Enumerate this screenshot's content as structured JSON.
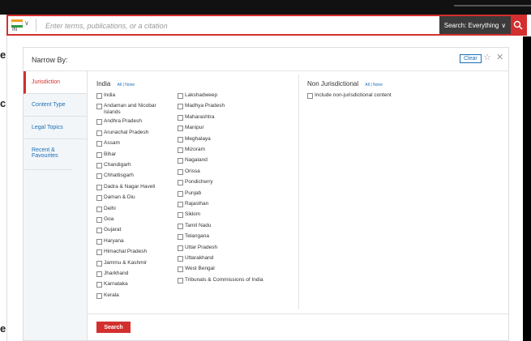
{
  "search": {
    "country_code": "IN",
    "placeholder": "Enter terms, publications, or a citation",
    "scope_label": "Search: Everything",
    "accent_color": "#d32f2f"
  },
  "panel": {
    "title": "Narrow By:",
    "clear_label": "Clear",
    "sidebar": [
      {
        "label": "Jurisdiction",
        "active": true
      },
      {
        "label": "Content Type",
        "active": false
      },
      {
        "label": "Legal Topics",
        "active": false
      },
      {
        "label": "Recent & Favourites",
        "active": false
      }
    ],
    "india": {
      "heading": "India",
      "all_label": "All",
      "none_label": "None",
      "col1": [
        "India",
        "Andaman and Nicobar Islands",
        "Andhra Pradesh",
        "Arunachal Pradesh",
        "Assam",
        "Bihar",
        "Chandigarh",
        "Chhattisgarh",
        "Dadra & Nagar Haveli",
        "Daman & Diu",
        "Delhi",
        "Goa",
        "Gujarat",
        "Haryana",
        "Himachal Pradesh",
        "Jammu & Kashmir",
        "Jharkhand",
        "Karnataka",
        "Kerala"
      ],
      "col2": [
        "Lakshadweep",
        "Madhya Pradesh",
        "Maharashtra",
        "Manipur",
        "Meghalaya",
        "Mizoram",
        "Nagaland",
        "Orissa",
        "Pondicherry",
        "Punjab",
        "Rajasthan",
        "Sikkim",
        "Tamil Nadu",
        "Telangana",
        "Uttar Pradesh",
        "Uttarakhand",
        "West Bengal",
        "Tribunals & Commissions of India"
      ]
    },
    "non_juris": {
      "heading": "Non Jurisdictional",
      "all_label": "All",
      "none_label": "None",
      "item": "Include non-jurisdictional content"
    },
    "search_label": "Search"
  },
  "edge_chars": [
    "e",
    "c",
    "e"
  ]
}
